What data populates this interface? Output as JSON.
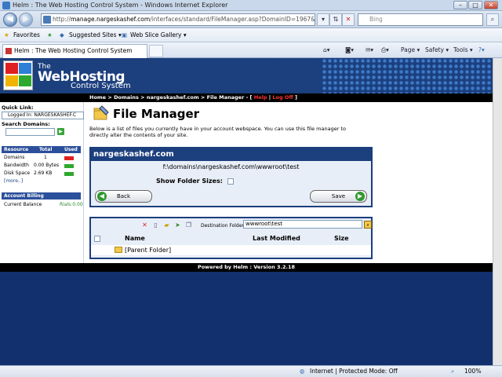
{
  "window": {
    "title": "Helm : The Web Hosting Control System - Windows Internet Explorer"
  },
  "browser": {
    "address_domain": "manage.nargeskashef.com",
    "address_prefix": "http://",
    "address_rest": "/interfaces/standard/FileManager.asp?DomainID=1967&showFo",
    "search_placeholder": "Bing",
    "favorites_label": "Favorites",
    "suggested_sites": "Suggested Sites ▾",
    "web_slice_gallery": "Web Slice Gallery ▾",
    "tab_title": "Helm : The Web Hosting Control System",
    "commands": {
      "page": "Page ▾",
      "safety": "Safety ▾",
      "tools": "Tools ▾"
    },
    "status_zone": "Internet | Protected Mode: Off",
    "zoom": "100%"
  },
  "banner": {
    "the": "The",
    "webhosting": "WebHosting",
    "control": "Control System"
  },
  "breadcrumb": {
    "home": "Home",
    "domains": "Domains",
    "domain": "nargeskashef.com",
    "page": "File Manager",
    "help": "Help",
    "logoff": "Log Off",
    "sep": " > "
  },
  "sidebar": {
    "quick_link_label": "Quick Link:",
    "logged_in": "Logged In: NARGESKASHEF.C",
    "search_label": "Search Domains:",
    "resource_header": {
      "resource": "Resource",
      "total": "Total",
      "used": "Used"
    },
    "resources": [
      {
        "name": "Domains",
        "total": "1",
        "color": "#e02020"
      },
      {
        "name": "Bandwidth",
        "total": "0.00 Bytes",
        "color": "#2ea82e"
      },
      {
        "name": "Disk Space",
        "total": "2.69 KB",
        "color": "#2ea82e"
      }
    ],
    "more": "[more..]",
    "billing_header": "Account Billing",
    "current_balance_label": "Current Balance",
    "current_balance_value": "Rials:0.00"
  },
  "main": {
    "title": "File Manager",
    "description": "Below is a list of files you currently have in your account webspace. You can use this file manager to directly alter the contents of your site.",
    "panel_domain": "nargeskashef.com",
    "current_path": "f:\\domains\\nargeskashef.com\\wwwroot\\test",
    "show_folder_sizes": "Show Folder Sizes:",
    "back_button": "Back",
    "save_button": "Save",
    "destination_label": "Destination Folder:",
    "destination_value": "wwwroot\\test",
    "columns": {
      "name": "Name",
      "modified": "Last Modified",
      "size": "Size"
    },
    "rows": [
      {
        "name": "[Parent Folder]"
      }
    ]
  },
  "footer": {
    "powered": "Powered by Helm :  Version 3.2.18"
  }
}
